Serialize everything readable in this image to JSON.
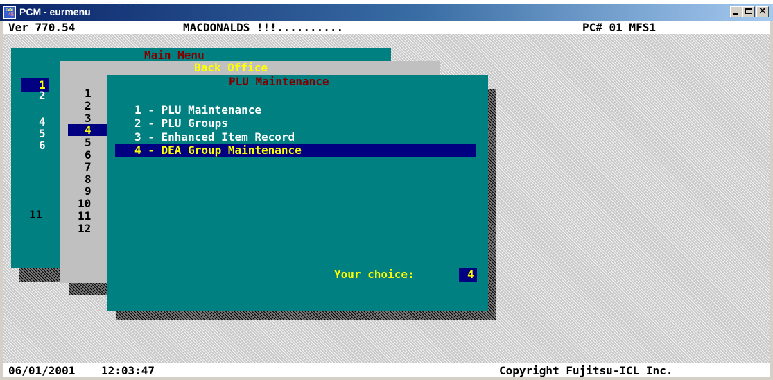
{
  "top_strip": ".............. .. .. ...",
  "window": {
    "title": "PCM - eurmenu",
    "icon_text_top": "ISS",
    "icon_text_bottom": "45",
    "controls": {
      "minimize": "minimize",
      "maximize": "maximize",
      "close": "✕"
    }
  },
  "status_line": {
    "version": "Ver 770.54",
    "store": "MACDONALDS !!!..........",
    "pc": "PC# 01 MFS1"
  },
  "main_menu": {
    "title": "Main Menu",
    "selected": "1",
    "items": [
      "2",
      "4",
      "5",
      "6",
      "11"
    ]
  },
  "back_office": {
    "title": "Back Office",
    "selected": "4",
    "items": [
      "1",
      "2",
      "3",
      "5",
      "6",
      "7",
      "8",
      "9",
      "10",
      "11",
      "12"
    ]
  },
  "plu_maintenance": {
    "title": "PLU Maintenance",
    "options": [
      "1 - PLU Maintenance",
      "2 - PLU Groups",
      "3 - Enhanced Item Record",
      "4 - DEA Group Maintenance"
    ],
    "selected_index": 3,
    "choice_label": "Your choice:",
    "choice_value": "4"
  },
  "bottom_line": {
    "date": "06/01/2001",
    "time": "12:03:47",
    "copyright": "Copyright Fujitsu-ICL Inc."
  },
  "colors": {
    "teal": "#008080",
    "grey": "#c0c0c0",
    "highlight": "#000080",
    "title_red": "#800000",
    "title_yellow": "#ffff00"
  }
}
